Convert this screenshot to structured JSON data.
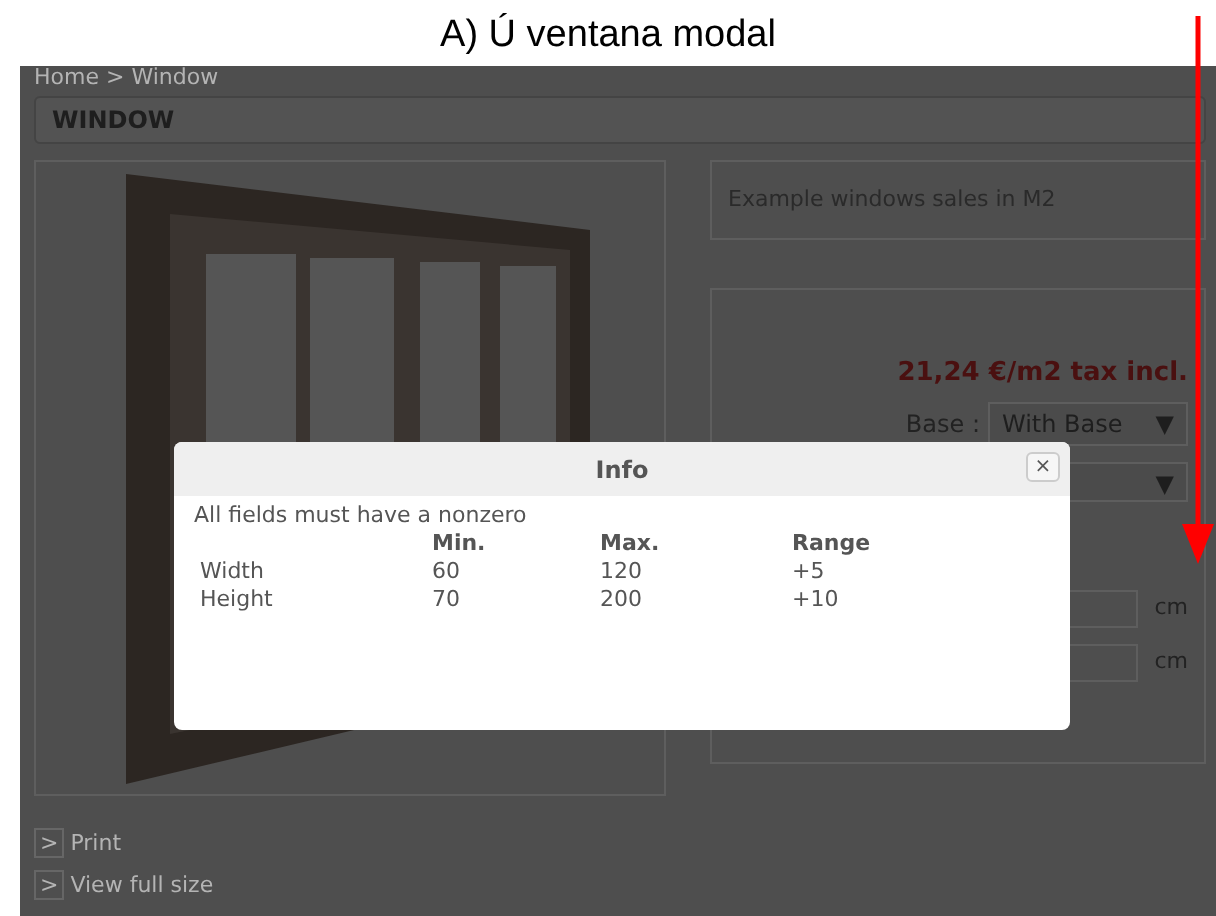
{
  "caption": "A) Ú ventana modal",
  "breadcrumb": "Home > Window",
  "page_title": "WINDOW",
  "product_description": "Example windows sales in M2",
  "price": "21,24 €/m2 tax incl.",
  "base": {
    "label": "Base :",
    "value": "With Base",
    "arrow": "▼"
  },
  "option_select": {
    "arrow": "▼"
  },
  "size_inputs": [
    {
      "unit": "cm"
    },
    {
      "unit": "cm"
    }
  ],
  "links": [
    {
      "arrow": ">",
      "label": "Print"
    },
    {
      "arrow": ">",
      "label": "View full size"
    }
  ],
  "modal": {
    "title": "Info",
    "close": "×",
    "message": "All fields must have a nonzero",
    "columns": [
      "Min.",
      "Max.",
      "Range"
    ],
    "rows": [
      {
        "label": "Width",
        "values": [
          "60",
          "120",
          "+5"
        ]
      },
      {
        "label": "Height",
        "values": [
          "70",
          "200",
          "+10"
        ]
      }
    ]
  }
}
